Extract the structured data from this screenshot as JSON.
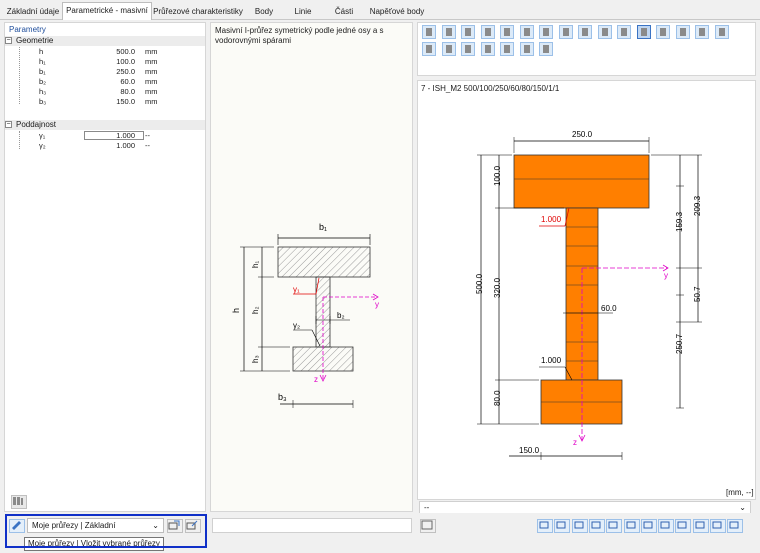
{
  "tabs": [
    "Základní údaje",
    "Parametrické - masivní II",
    "Průřezové charakteristiky",
    "Body",
    "Linie",
    "Části",
    "Napěťové body"
  ],
  "active_tab": 1,
  "params": {
    "title": "Parametry",
    "geometry_group": "Geometrie",
    "rows": [
      {
        "label": "h",
        "value": "500.0",
        "unit": "mm"
      },
      {
        "label": "h₁",
        "value": "100.0",
        "unit": "mm"
      },
      {
        "label": "b₁",
        "value": "250.0",
        "unit": "mm"
      },
      {
        "label": "b₂",
        "value": "60.0",
        "unit": "mm"
      },
      {
        "label": "h₃",
        "value": "80.0",
        "unit": "mm"
      },
      {
        "label": "b₃",
        "value": "150.0",
        "unit": "mm"
      }
    ],
    "compliance_group": "Poddajnost",
    "compliance_rows": [
      {
        "label": "γ₁",
        "value": "1.000",
        "unit": "--"
      },
      {
        "label": "γ₂",
        "value": "1.000",
        "unit": "--"
      }
    ]
  },
  "description": "Masivní I-průřez symetrický podle jedné osy a s vodorovnými spárami",
  "schematic": {
    "b1": "b₁",
    "h1": "h₁",
    "h": "h",
    "h2": "h₂",
    "h3": "h₃",
    "b2": "b₂",
    "b3": "b₃",
    "y1": "γ₁",
    "y2": "γ₂",
    "y": "y",
    "z": "z"
  },
  "section": {
    "title": "7 - ISH_M2 500/100/250/60/80/150/1/1",
    "dims": {
      "top_width": "250.0",
      "left_total": "500.0",
      "left_top": "100.0",
      "left_mid": "320.0",
      "left_bot": "80.0",
      "right_top": "159.3",
      "right_top_total": "209.3",
      "right_bot": "50.7",
      "right_bot_total": "250.7",
      "web": "60.0",
      "bottom_width": "150.0",
      "gamma_top": "1.000",
      "gamma_bot": "1.000",
      "y": "y",
      "z": "z"
    },
    "units": "[mm, --]",
    "lower_combo": "--"
  },
  "bottom": {
    "combo_value": "Moje průřezy | Základní",
    "tooltip": "Moje průřezy | Vložit vybrané průřezy"
  },
  "colors": {
    "flange": "#ff7f00",
    "dim": "#000000",
    "axis": "#e000c8",
    "gamma": "#e00000"
  }
}
